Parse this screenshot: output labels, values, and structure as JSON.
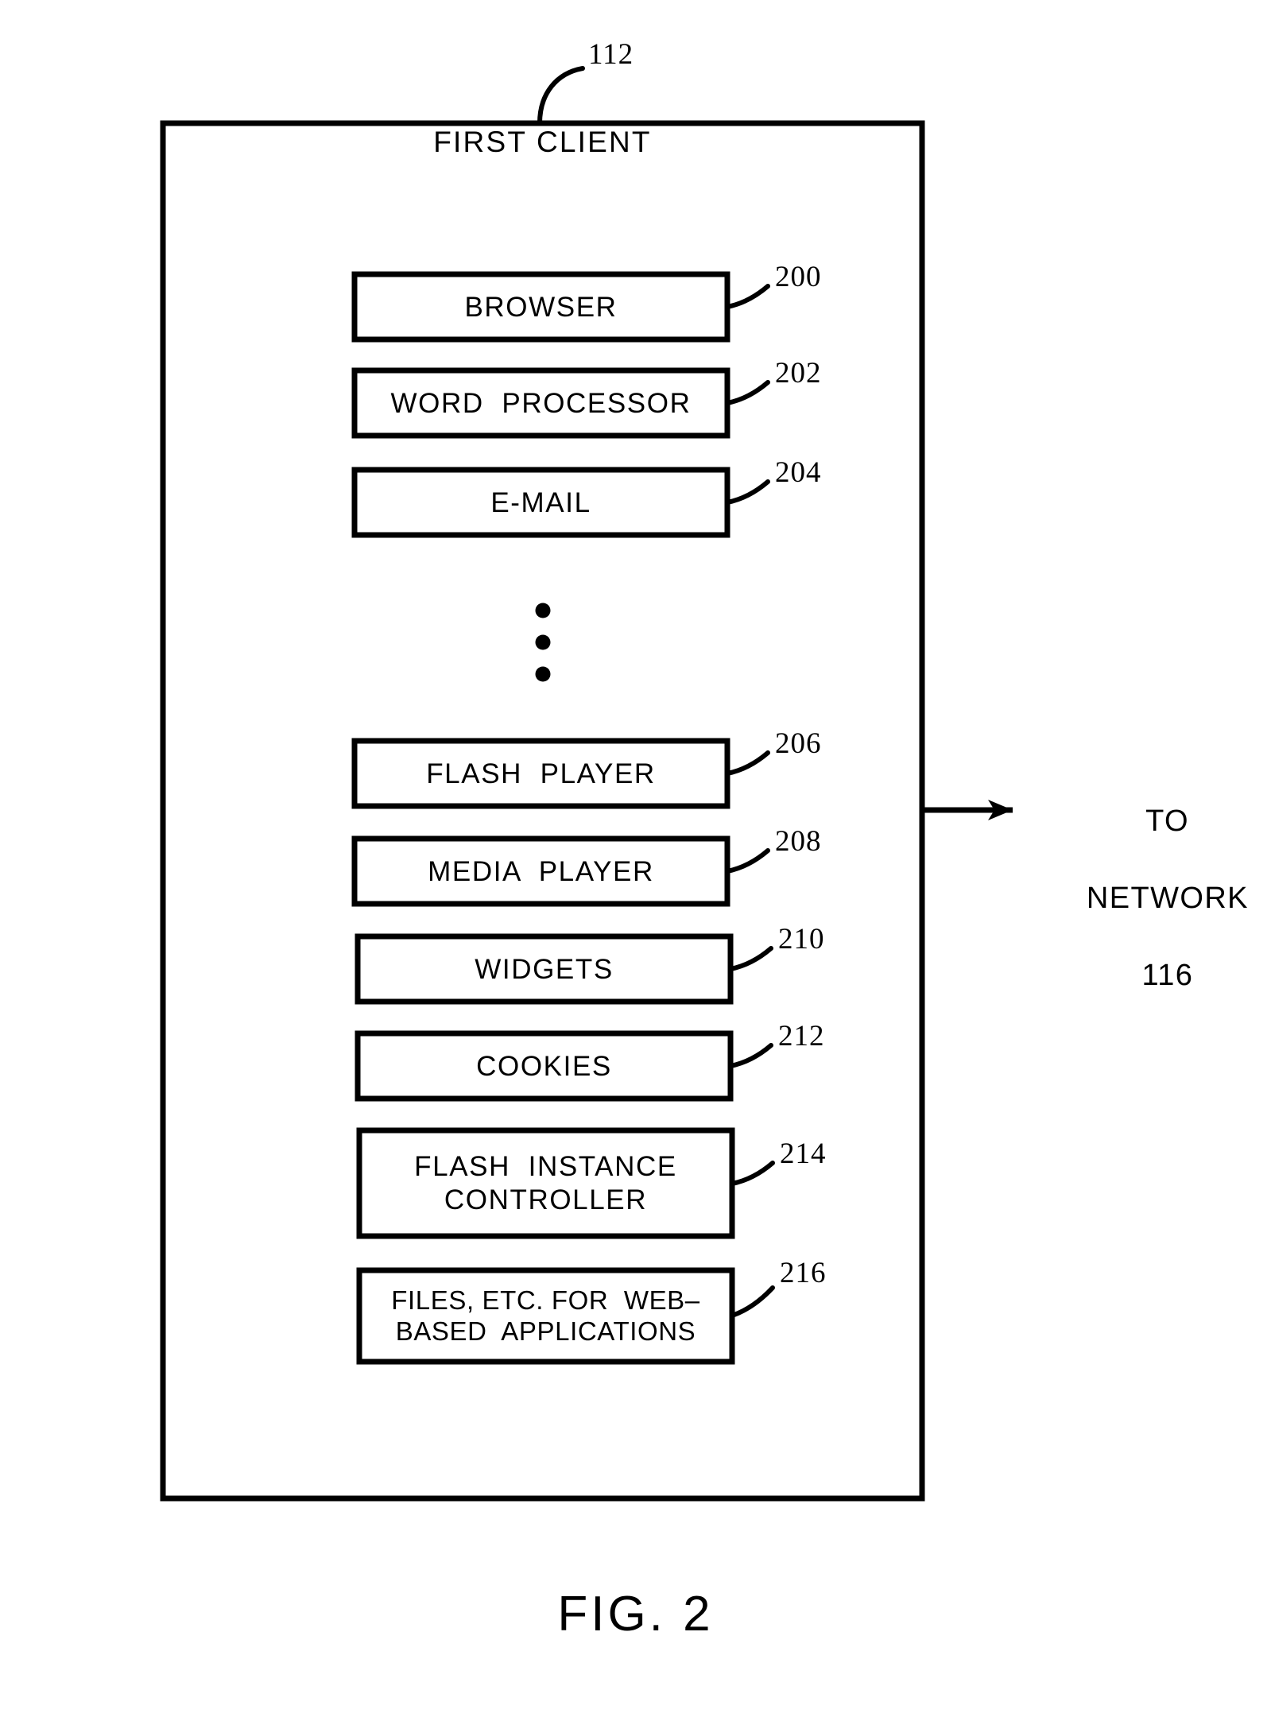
{
  "figure": {
    "caption": "FIG. 2",
    "container_ref": "112",
    "title": "FIRST CLIENT"
  },
  "network": {
    "line1": "TO",
    "line2": "NETWORK",
    "line3": "116",
    "arrow_icon": "right-arrow-icon"
  },
  "ellipsis": {
    "icon": "vertical-ellipsis-icon",
    "dot_count": 3
  },
  "blocks": [
    {
      "id": "browser",
      "label": "BROWSER",
      "label2": "",
      "ref": "200"
    },
    {
      "id": "word-processor",
      "label": "WORD  PROCESSOR",
      "label2": "",
      "ref": "202"
    },
    {
      "id": "email",
      "label": "E-MAIL",
      "label2": "",
      "ref": "204"
    },
    {
      "id": "flash-player",
      "label": "FLASH  PLAYER",
      "label2": "",
      "ref": "206"
    },
    {
      "id": "media-player",
      "label": "MEDIA  PLAYER",
      "label2": "",
      "ref": "208"
    },
    {
      "id": "widgets",
      "label": "WIDGETS",
      "label2": "",
      "ref": "210"
    },
    {
      "id": "cookies",
      "label": "COOKIES",
      "label2": "",
      "ref": "212"
    },
    {
      "id": "flash-instance-controller",
      "label": "FLASH  INSTANCE",
      "label2": "CONTROLLER",
      "ref": "214"
    },
    {
      "id": "files-web-based-applications",
      "label": "FILES, ETC. FOR  WEB–",
      "label2": "BASED  APPLICATIONS",
      "ref": "216"
    }
  ],
  "colors": {
    "stroke": "#000000",
    "background": "#ffffff"
  }
}
